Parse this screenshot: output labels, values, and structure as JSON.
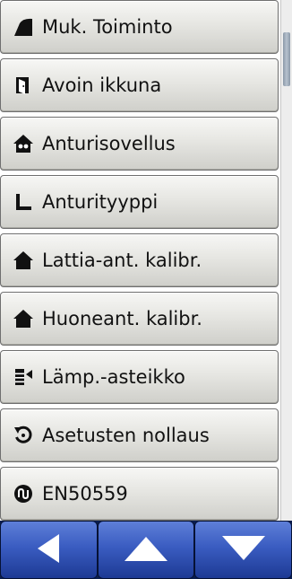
{
  "menu": {
    "items": [
      {
        "label": "Muk. Toiminto",
        "icon": "adaptive-function-icon"
      },
      {
        "label": "Avoin ikkuna",
        "icon": "open-window-icon"
      },
      {
        "label": "Anturisovellus",
        "icon": "sensor-application-icon"
      },
      {
        "label": "Anturityyppi",
        "icon": "sensor-type-icon"
      },
      {
        "label": "Lattia-ant. kalibr.",
        "icon": "floor-sensor-calibration-icon"
      },
      {
        "label": "Huoneant. kalibr.",
        "icon": "room-sensor-calibration-icon"
      },
      {
        "label": "Lämp.-asteikko",
        "icon": "temperature-scale-icon"
      },
      {
        "label": "Asetusten nollaus",
        "icon": "reset-icon"
      },
      {
        "label": "EN50559",
        "icon": "en50559-icon"
      }
    ]
  },
  "scrollbar": {
    "position": 0.04
  },
  "nav": {
    "buttons": [
      "back-arrow-icon",
      "up-arrow-icon",
      "down-arrow-icon"
    ]
  },
  "colors": {
    "nav_background": "#0a1d50",
    "nav_button": "#3a5cc1",
    "item_background": "#e6e6e2",
    "icon": "#111111"
  }
}
